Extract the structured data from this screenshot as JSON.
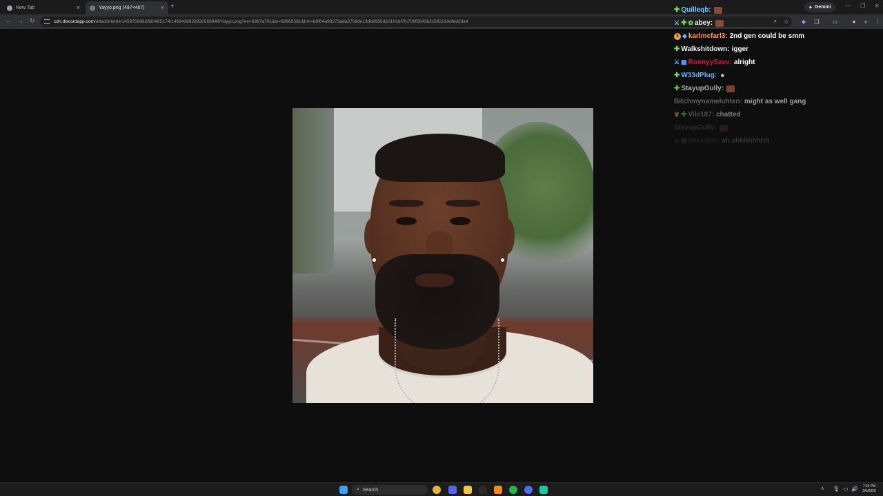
{
  "browser": {
    "tabs": [
      {
        "title": "New Tab"
      },
      {
        "title": "Yayyo.png (497×487)"
      }
    ],
    "new_tab_symbol": "+",
    "close_symbol": "×",
    "gemini_label": "Gemini",
    "url_host": "cdn.discordapp.com",
    "url_path": "/attachments/1459756662880465174/1469436628920569948/Yayyo.png?ex=6987a701&is=69865581&hm=b9f04a98273ada2708de13db8955d10101bf7fc709f5543b2c592210dfed28a4"
  },
  "image": {
    "file_name": "Yayyo.png",
    "natural_width": 497,
    "natural_height": 487
  },
  "chat": [
    {
      "badges": [
        "plus"
      ],
      "user": "Quilleqb:",
      "color": "#7ec8ff",
      "text": "",
      "emote": "block",
      "opacity": 1
    },
    {
      "badges": [
        "sword",
        "plus",
        "gear"
      ],
      "user": "abey:",
      "color": "#f0f0f0",
      "text": "",
      "emote": "block",
      "opacity": 1
    },
    {
      "badges": [
        "one",
        "cube"
      ],
      "user": "karlmcfarl3:",
      "color": "#ff9f5a",
      "text": "2nd gen could be smm",
      "emote": "",
      "opacity": 1
    },
    {
      "badges": [
        "plus"
      ],
      "user": "Walkshitdown:",
      "color": "#f0f0f0",
      "text": "igger",
      "emote": "",
      "opacity": 1
    },
    {
      "badges": [
        "sword",
        "chart"
      ],
      "user": "RonnyySavv:",
      "color": "#d01840",
      "text": "alright",
      "emote": "",
      "opacity": 1
    },
    {
      "badges": [
        "plus"
      ],
      "user": "W33dPlug:",
      "color": "#6fb0ff",
      "text": "",
      "emote": "face",
      "opacity": 1
    },
    {
      "badges": [
        "plus"
      ],
      "user": "StayupGully:",
      "color": "#c9c9c9",
      "text": "",
      "emote": "block",
      "opacity": 0.85
    },
    {
      "badges": [],
      "user": "Bitchmynameluhten:",
      "color": "#8f9b9f",
      "text": "might as well gang",
      "emote": "",
      "opacity": 0.6
    },
    {
      "badges": [
        "crown",
        "plus"
      ],
      "user": "Vile187:",
      "color": "#8f9b9f",
      "text": "chatted",
      "emote": "",
      "opacity": 0.45
    },
    {
      "badges": [],
      "user": "StayupGully:",
      "color": "#8f8f8f",
      "text": "",
      "emote": "block",
      "opacity": 0.22
    },
    {
      "badges": [
        "sword",
        "chart"
      ],
      "user": "ohsebrin:",
      "color": "#8f8f8f",
      "text": "ah ahhhhhhhh",
      "emote": "",
      "opacity": 0.15
    }
  ],
  "taskbar": {
    "search_placeholder": "Search",
    "time": "7:54 PM",
    "date": "2/6/2026",
    "apps": [
      {
        "name": "start",
        "color": "#3da0f5"
      },
      {
        "name": "chrome",
        "color": "#e8b53a"
      },
      {
        "name": "discord",
        "color": "#5865f2"
      },
      {
        "name": "file-explorer",
        "color": "#f4c542"
      },
      {
        "name": "xbox",
        "color": "#2a2a2a"
      },
      {
        "name": "vlc",
        "color": "#f28a1e"
      },
      {
        "name": "spotify",
        "color": "#1db954"
      },
      {
        "name": "arc",
        "color": "#4b6ef5"
      },
      {
        "name": "app-teal",
        "color": "#1bc7a2"
      }
    ]
  }
}
